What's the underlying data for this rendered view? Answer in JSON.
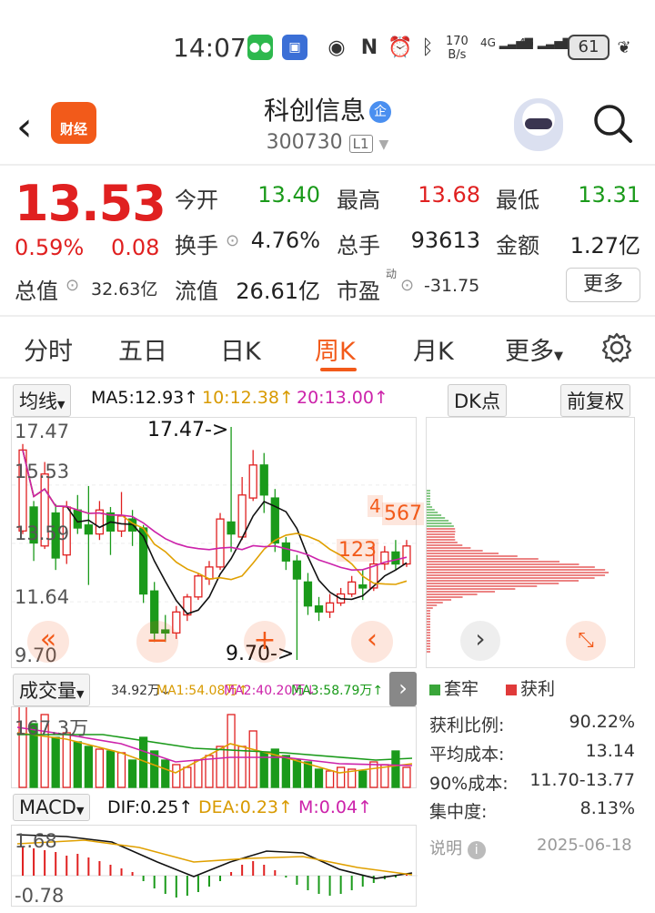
{
  "status_bar": {
    "time": "14:07",
    "net_speed_top": "170",
    "net_speed_bottom": "B/s",
    "sig1": "4G",
    "sig2": "4G",
    "battery": "61"
  },
  "header": {
    "back_icon": "chevron-left",
    "app_logo_text": "财经",
    "stock_name": "科创信息",
    "stock_badge": "企",
    "stock_code": "300730",
    "level_badge": "L1"
  },
  "quote": {
    "price": "13.53",
    "change_pct": "0.59%",
    "change_amt": "0.08",
    "open_label": "今开",
    "open_value": "13.40",
    "high_label": "最高",
    "high_value": "13.68",
    "low_label": "最低",
    "low_value": "13.31",
    "turnover_label": "换手",
    "turnover_value": "4.76%",
    "volume_label": "总手",
    "volume_value": "93613",
    "amount_label": "金额",
    "amount_value": "1.27亿",
    "total_cap_label": "总值",
    "total_cap_value": "32.63亿",
    "float_cap_label": "流值",
    "float_cap_value": "26.61亿",
    "pe_label": "市盈",
    "pe_sup": "动",
    "pe_value": "-31.75",
    "more_button": "更多"
  },
  "tabs": [
    {
      "label": "分时"
    },
    {
      "label": "五日"
    },
    {
      "label": "日K"
    },
    {
      "label": "周K"
    },
    {
      "label": "月K"
    },
    {
      "label": "更多"
    }
  ],
  "active_tab": "周K",
  "indicators": {
    "ma_selector": "均线",
    "ma5": "MA5:12.93↑",
    "ma10": "10:12.38↑",
    "ma20": "20:13.00↑",
    "dk_button": "DK点",
    "adjust_button": "前复权"
  },
  "kchart": {
    "y_labels": [
      "17.47",
      "15.53",
      "13.59",
      "11.64",
      "9.70"
    ],
    "high_annotation": "17.47->",
    "low_annotation": "9.70->",
    "signal_labels": [
      "4",
      "567",
      "123"
    ]
  },
  "volume": {
    "selector": "成交量",
    "value": "34.92万↓",
    "ma1": "MA1:54.08万↑",
    "ma2": "MA2:40.20万↓",
    "ma3": "MA3:58.79万↑",
    "y_label": "167.3万"
  },
  "macd": {
    "selector": "MACD",
    "dif": "DIF:0.25↑",
    "dea": "DEA:0.23↑",
    "m": "M:0.04↑",
    "y_top": "1.68",
    "y_bottom": "-0.78"
  },
  "chip": {
    "legend_trapped": "套牢",
    "legend_profit": "获利",
    "rows": [
      {
        "label": "获利比例:",
        "value": "90.22%"
      },
      {
        "label": "平均成本:",
        "value": "13.14"
      },
      {
        "label": "90%成本:",
        "value": "11.70-13.77"
      },
      {
        "label": "集中度:",
        "value": "8.13%"
      }
    ],
    "note_label": "说明",
    "date": "2025-06-18"
  },
  "colors": {
    "up": "#e02020",
    "down": "#1a9a1a",
    "accent": "#f25a1a",
    "ma5": "#111111",
    "ma10": "#e0a000",
    "ma20": "#cc22aa"
  }
}
